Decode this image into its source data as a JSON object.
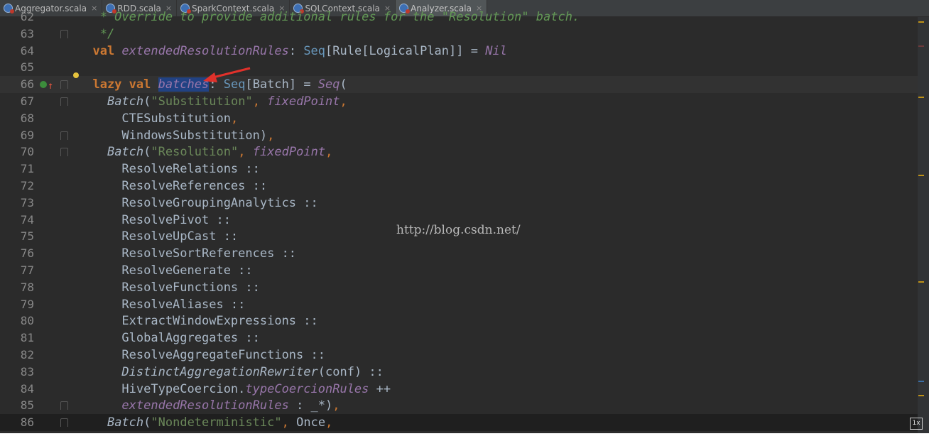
{
  "tabs": [
    {
      "label": "Aggregator.scala",
      "close": "×",
      "active": false
    },
    {
      "label": "RDD.scala",
      "close": "×",
      "active": false
    },
    {
      "label": "SparkContext.scala",
      "close": "×",
      "active": false
    },
    {
      "label": "SQLContext.scala",
      "close": "×",
      "active": false
    },
    {
      "label": "Analyzer.scala",
      "close": "×",
      "active": true
    }
  ],
  "editor": {
    "line_numbers": [
      "62",
      "63",
      "64",
      "65",
      "66",
      "67",
      "68",
      "69",
      "70",
      "71",
      "72",
      "73",
      "74",
      "75",
      "76",
      "77",
      "78",
      "79",
      "80",
      "81",
      "82",
      "83",
      "84",
      "85",
      "86"
    ],
    "lines": [
      [
        {
          "t": "   * Override to provide additional rules for the \"Resolution\" batch.",
          "c": "cmt"
        }
      ],
      [
        {
          "t": "   */",
          "c": "cmt"
        }
      ],
      [
        {
          "t": "  val ",
          "c": "kw"
        },
        {
          "t": "extendedResolutionRules",
          "c": "it"
        },
        {
          "t": ": "
        },
        {
          "t": "Seq",
          "c": "type"
        },
        {
          "t": "[Rule[LogicalPlan]] = "
        },
        {
          "t": "Nil",
          "c": "it"
        }
      ],
      [
        {
          "t": ""
        }
      ],
      [
        {
          "t": "  lazy val ",
          "c": "kw"
        },
        {
          "t": "batches",
          "c": "sel"
        },
        {
          "t": ": "
        },
        {
          "t": "Seq",
          "c": "type"
        },
        {
          "t": "[Batch] = "
        },
        {
          "t": "Seq",
          "c": "it"
        },
        {
          "t": "("
        }
      ],
      [
        {
          "t": "    "
        },
        {
          "t": "Batch",
          "c": "ital"
        },
        {
          "t": "("
        },
        {
          "t": "\"Substitution\"",
          "c": "str"
        },
        {
          "t": ", ",
          "c": "punct"
        },
        {
          "t": "fixedPoint",
          "c": "it"
        },
        {
          "t": ",",
          "c": "punct"
        }
      ],
      [
        {
          "t": "      CTESubstitution"
        },
        {
          "t": ",",
          "c": "punct"
        }
      ],
      [
        {
          "t": "      WindowsSubstitution)"
        },
        {
          "t": ",",
          "c": "punct"
        }
      ],
      [
        {
          "t": "    "
        },
        {
          "t": "Batch",
          "c": "ital"
        },
        {
          "t": "("
        },
        {
          "t": "\"Resolution\"",
          "c": "str"
        },
        {
          "t": ", ",
          "c": "punct"
        },
        {
          "t": "fixedPoint",
          "c": "it"
        },
        {
          "t": ",",
          "c": "punct"
        }
      ],
      [
        {
          "t": "      ResolveRelations ::"
        }
      ],
      [
        {
          "t": "      ResolveReferences ::"
        }
      ],
      [
        {
          "t": "      ResolveGroupingAnalytics ::"
        }
      ],
      [
        {
          "t": "      ResolvePivot ::"
        }
      ],
      [
        {
          "t": "      ResolveUpCast ::"
        }
      ],
      [
        {
          "t": "      ResolveSortReferences ::"
        }
      ],
      [
        {
          "t": "      ResolveGenerate ::"
        }
      ],
      [
        {
          "t": "      ResolveFunctions ::"
        }
      ],
      [
        {
          "t": "      ResolveAliases ::"
        }
      ],
      [
        {
          "t": "      ExtractWindowExpressions ::"
        }
      ],
      [
        {
          "t": "      GlobalAggregates ::"
        }
      ],
      [
        {
          "t": "      ResolveAggregateFunctions ::"
        }
      ],
      [
        {
          "t": "      "
        },
        {
          "t": "DistinctAggregationRewriter",
          "c": "ital"
        },
        {
          "t": "(conf) ::"
        }
      ],
      [
        {
          "t": "      HiveTypeCoercion."
        },
        {
          "t": "typeCoercionRules",
          "c": "it"
        },
        {
          "t": " ++"
        }
      ],
      [
        {
          "t": "      "
        },
        {
          "t": "extendedResolutionRules",
          "c": "it"
        },
        {
          "t": " : _*)"
        },
        {
          "t": ",",
          "c": "punct"
        }
      ],
      [
        {
          "t": "    "
        },
        {
          "t": "Batch",
          "c": "ital"
        },
        {
          "t": "("
        },
        {
          "t": "\"Nondeterministic\"",
          "c": "str"
        },
        {
          "t": ", ",
          "c": "punct"
        },
        {
          "t": "Once"
        },
        {
          "t": ",",
          "c": "punct"
        }
      ]
    ]
  },
  "watermark": "http://blog.csdn.net/",
  "zoom_badge": "1x",
  "colors": {
    "background": "#2b2b2b",
    "keyword": "#cc7832",
    "string": "#6a8759",
    "field": "#9876aa",
    "selection": "#214283",
    "arrow": "#e0312b"
  },
  "icons": [
    "scala-file-icon",
    "close-icon",
    "override-gutter-icon",
    "bulb-icon",
    "fold-icon",
    "annotation-arrow"
  ]
}
